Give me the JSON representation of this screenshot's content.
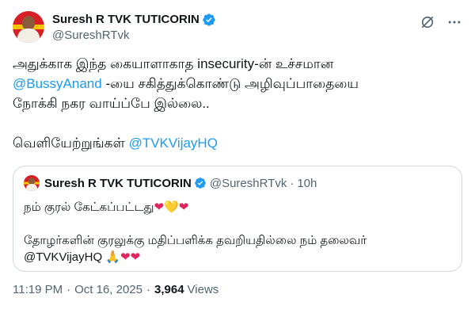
{
  "author": {
    "display_name": "Suresh R TVK TUTICORIN",
    "handle": "@SureshRTvk"
  },
  "icons": {
    "verified": "verified-badge-icon",
    "grok": "grok-icon",
    "more": "more-options-icon",
    "verified_color": "#1d9bf0"
  },
  "tweet": {
    "line1": "அதுக்காக இந்த கையாளாகாத insecurity-ன் உச்சமான",
    "mention1": "@BussyAnand",
    "line2_rest": " -யை சகித்துக்கொண்டு அழிவுப்பாதையை",
    "line3": "நோக்கி நகர வாய்ப்பே இல்லை..",
    "line4_prefix": "வெளியேற்றுங்கள் ",
    "mention2": "@TVKVijayHQ"
  },
  "quote": {
    "display_name": "Suresh R TVK TUTICORIN",
    "handle": "@SureshRTvk",
    "separator": "·",
    "time_ago": "10h",
    "text1": "நம் குரல் கேட்கப்பட்டது",
    "text1_emoji": [
      "❤",
      "💛",
      "❤"
    ],
    "text2": "தோழர்களின் குரலுக்கு மதிப்பளிக்க தவறியதில்லை நம் தலைவர்",
    "text3": "@TVKVijayHQ",
    "text3_emoji": [
      "🙏",
      "❤",
      "❤"
    ]
  },
  "footer": {
    "time": "11:19 PM",
    "date": "Oct 16, 2025",
    "separator": "·",
    "views_count": "3,964",
    "views_label": "Views"
  }
}
